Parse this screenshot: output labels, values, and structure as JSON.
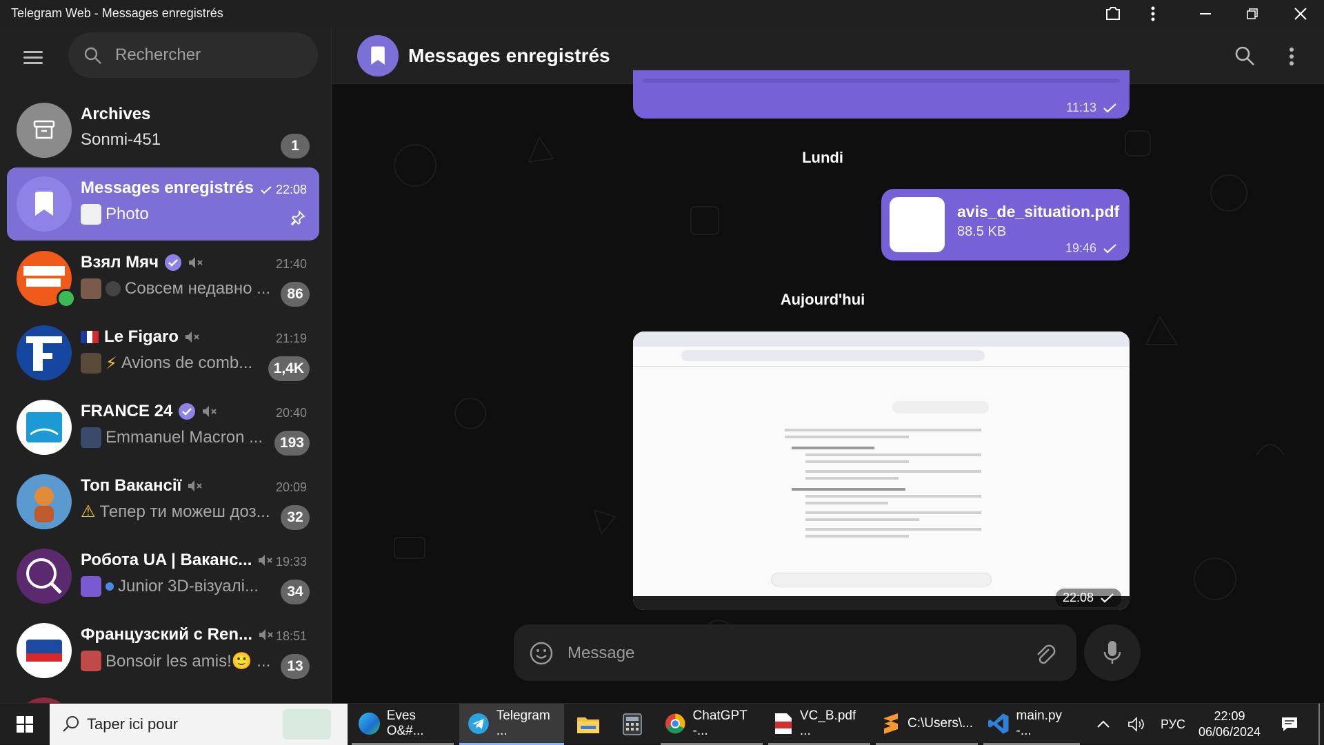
{
  "window": {
    "title": "Telegram Web - Messages enregistrés"
  },
  "sidebar": {
    "search_placeholder": "Rechercher",
    "chats": [
      {
        "name": "Archives",
        "preview": "Sonmi-451",
        "badge": "1",
        "time": ""
      },
      {
        "name": "Messages enregistrés",
        "preview": "Photo",
        "time": "22:08",
        "badge": ""
      },
      {
        "name": "Взял Мяч",
        "preview": "Совсем недавно ...",
        "time": "21:40",
        "badge": "86"
      },
      {
        "name": "Le Figaro",
        "preview": "Avions de comb...",
        "time": "21:19",
        "badge": "1,4K"
      },
      {
        "name": "FRANCE 24",
        "preview": "Emmanuel Macron ...",
        "time": "20:40",
        "badge": "193"
      },
      {
        "name": "Топ Вакансії",
        "preview": "Тепер ти можеш доз...",
        "time": "20:09",
        "badge": "32"
      },
      {
        "name": "Робота UA | Ваканс...",
        "preview": "Junior 3D-візуалі...",
        "time": "19:33",
        "badge": "34"
      },
      {
        "name": "Французский с Ren...",
        "preview": "Bonsoir les amis!🙂 ...",
        "time": "18:51",
        "badge": "13"
      }
    ]
  },
  "chat": {
    "title": "Messages enregistrés",
    "messages": {
      "first_time": "11:13",
      "date_1": "Lundi",
      "file_name": "avis_de_situation.pdf",
      "file_size": "88.5 KB",
      "file_time": "19:46",
      "date_2": "Aujourd'hui",
      "photo_time": "22:08"
    },
    "composer_placeholder": "Message"
  },
  "taskbar": {
    "search_placeholder": "Taper ici pour",
    "items": [
      {
        "label": "Eves O&#..."
      },
      {
        "label": "Telegram ..."
      },
      {
        "label": "ChatGPT -..."
      },
      {
        "label": "VC_B.pdf ..."
      },
      {
        "label": "C:\\Users\\..."
      },
      {
        "label": "main.py -..."
      }
    ],
    "lang": "РУС",
    "time": "22:09",
    "date": "06/06/2024"
  },
  "colors": {
    "accent": "#7662d6",
    "sidebar_bg": "#212121",
    "main_bg": "#0f0f0f",
    "badge": "#666666"
  }
}
